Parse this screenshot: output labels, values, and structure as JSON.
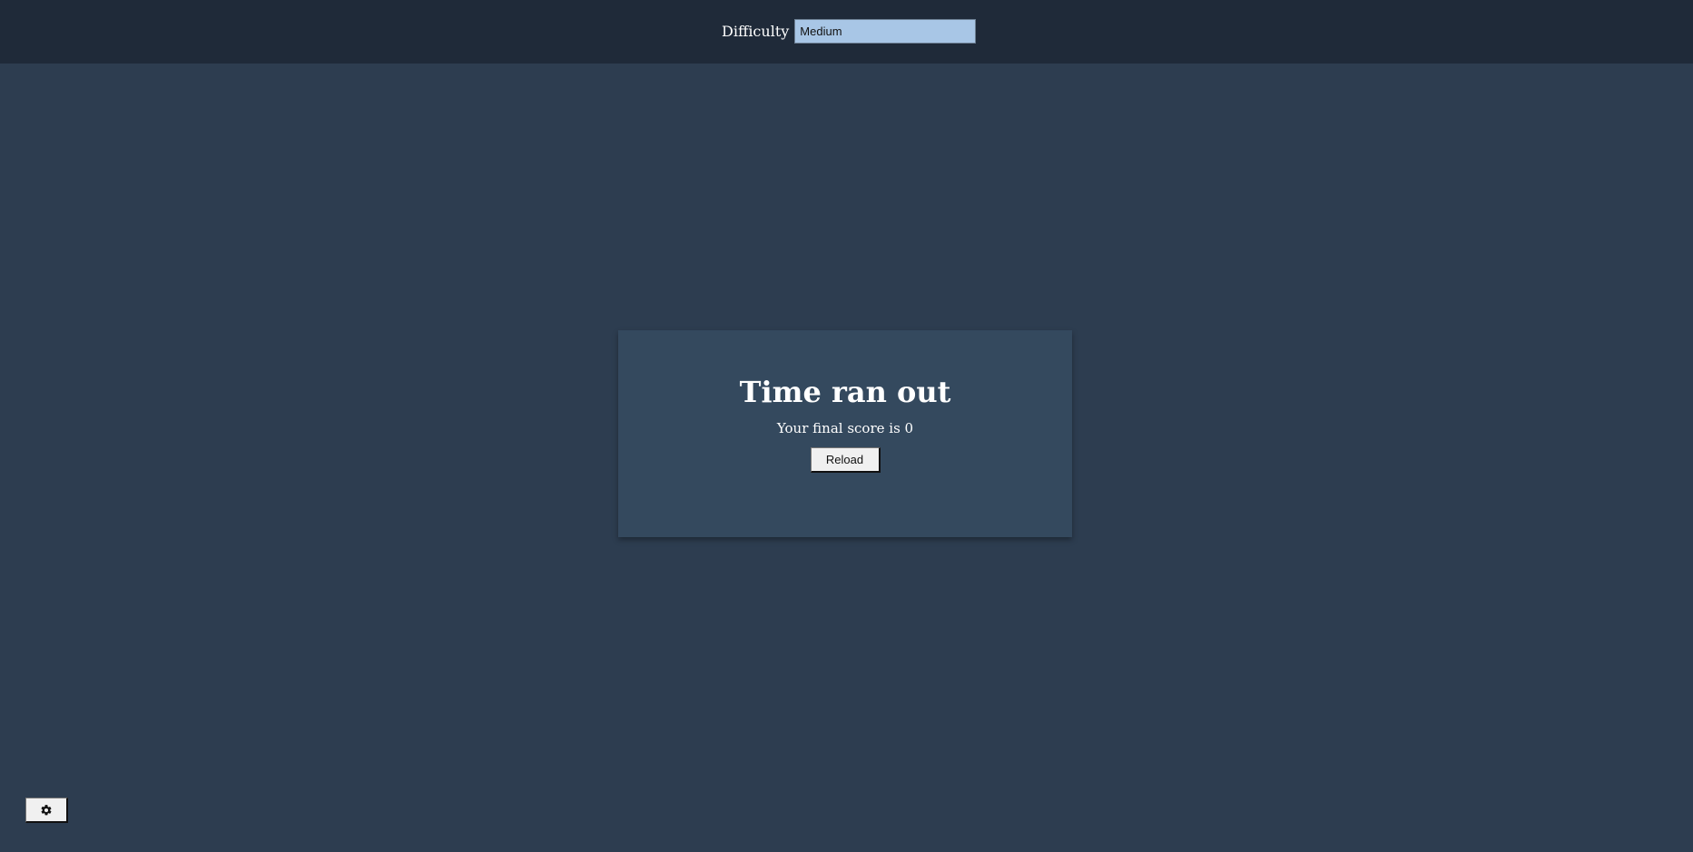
{
  "header": {
    "difficulty_label": "Difficulty",
    "difficulty_value": "Medium"
  },
  "modal": {
    "title": "Time ran out",
    "message": "Your final score is 0",
    "reload_label": "Reload"
  },
  "footer": {
    "settings_icon": "gear-icon"
  },
  "colors": {
    "background": "#2d3d50",
    "topbar": "#1f2a39",
    "modal": "#34495e",
    "select_bg": "#a8c6e6"
  }
}
